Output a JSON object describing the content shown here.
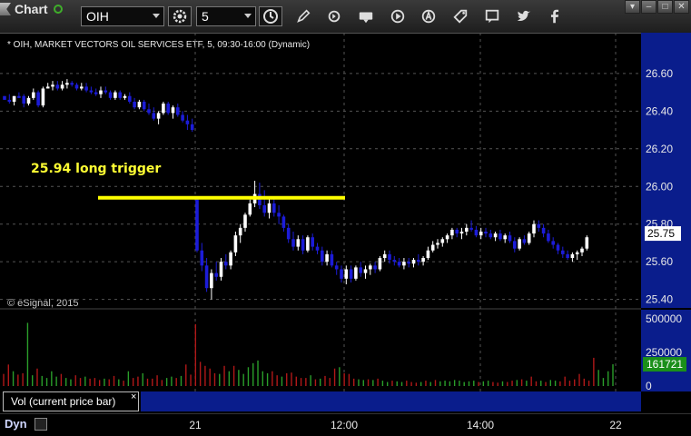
{
  "toolbar": {
    "title": "Chart",
    "symbol": "OIH",
    "interval": "5",
    "icons": [
      "pencil-icon",
      "refresh-icon",
      "get-icon",
      "play-icon",
      "alert-icon",
      "tag-icon",
      "chat-icon",
      "twitter-icon",
      "facebook-icon"
    ]
  },
  "window_controls": [
    "▾",
    "–",
    "□",
    "✕"
  ],
  "chart_header": "* OIH, MARKET VECTORS OIL SERVICES ETF, 5, 09:30-16:00 (Dynamic)",
  "watermark": "© eSignal, 2015",
  "annotation": "25.94 long trigger",
  "vol_study_label": "Vol (current price bar)",
  "vol_close_glyph": "×",
  "dyn_label": "Dyn",
  "colors": {
    "up": "#ffffff",
    "down": "#1c1cd8",
    "trigger": "#ffff00",
    "axis_bg": "#0a1d8c",
    "vol_up": "#2a9e2a",
    "vol_down": "#b01818"
  },
  "chart_data": [
    {
      "type": "candlestick",
      "ylim": [
        25.35,
        26.72
      ],
      "y_ticks": [
        26.6,
        26.4,
        26.2,
        26.0,
        25.8,
        25.6,
        25.4
      ],
      "x_ticks": [
        "21",
        "12:00",
        "14:00",
        "22"
      ],
      "last_price": "25.75",
      "trigger_level": 25.94,
      "session_break_bar": 40,
      "candles": [
        [
          26.48,
          26.48,
          26.46,
          26.46
        ],
        [
          26.46,
          26.49,
          26.44,
          26.45
        ],
        [
          26.45,
          26.48,
          26.43,
          26.48
        ],
        [
          26.48,
          26.5,
          26.47,
          26.47
        ],
        [
          26.48,
          26.49,
          26.42,
          26.44
        ],
        [
          26.44,
          26.48,
          26.43,
          26.47
        ],
        [
          26.47,
          26.52,
          26.46,
          26.5
        ],
        [
          26.5,
          26.51,
          26.42,
          26.43
        ],
        [
          26.43,
          26.53,
          26.42,
          26.52
        ],
        [
          26.52,
          26.55,
          26.52,
          26.53
        ],
        [
          26.53,
          26.56,
          26.51,
          26.54
        ],
        [
          26.54,
          26.56,
          26.51,
          26.52
        ],
        [
          26.52,
          26.56,
          26.51,
          26.54
        ],
        [
          26.54,
          26.57,
          26.52,
          26.55
        ],
        [
          26.55,
          26.56,
          26.53,
          26.54
        ],
        [
          26.54,
          26.55,
          26.51,
          26.52
        ],
        [
          26.52,
          26.55,
          26.51,
          26.53
        ],
        [
          26.53,
          26.55,
          26.5,
          26.51
        ],
        [
          26.51,
          26.53,
          26.49,
          26.5
        ],
        [
          26.5,
          26.52,
          26.48,
          26.49
        ],
        [
          26.49,
          26.53,
          26.47,
          26.51
        ],
        [
          26.51,
          26.53,
          26.49,
          26.5
        ],
        [
          26.5,
          26.51,
          26.46,
          26.47
        ],
        [
          26.47,
          26.51,
          26.46,
          26.5
        ],
        [
          26.5,
          26.51,
          26.46,
          26.47
        ],
        [
          26.47,
          26.49,
          26.46,
          26.48
        ],
        [
          26.48,
          26.5,
          26.44,
          26.45
        ],
        [
          26.45,
          26.47,
          26.41,
          26.42
        ],
        [
          26.42,
          26.46,
          26.41,
          26.45
        ],
        [
          26.45,
          26.46,
          26.4,
          26.41
        ],
        [
          26.41,
          26.44,
          26.38,
          26.39
        ],
        [
          26.39,
          26.42,
          26.35,
          26.36
        ],
        [
          26.36,
          26.4,
          26.33,
          26.39
        ],
        [
          26.39,
          26.45,
          26.38,
          26.44
        ],
        [
          26.44,
          26.45,
          26.38,
          26.39
        ],
        [
          26.39,
          26.43,
          26.36,
          26.42
        ],
        [
          26.42,
          26.44,
          26.37,
          26.38
        ],
        [
          26.38,
          26.4,
          26.34,
          26.35
        ],
        [
          26.35,
          26.38,
          26.3,
          26.33
        ],
        [
          26.33,
          26.36,
          26.29,
          26.3
        ],
        [
          25.94,
          25.94,
          25.65,
          25.66
        ],
        [
          25.66,
          25.7,
          25.55,
          25.58
        ],
        [
          25.58,
          25.62,
          25.44,
          25.46
        ],
        [
          25.46,
          25.56,
          25.4,
          25.54
        ],
        [
          25.54,
          25.6,
          25.5,
          25.52
        ],
        [
          25.52,
          25.62,
          25.5,
          25.6
        ],
        [
          25.6,
          25.64,
          25.56,
          25.58
        ],
        [
          25.58,
          25.66,
          25.56,
          25.65
        ],
        [
          25.65,
          25.76,
          25.63,
          25.74
        ],
        [
          25.74,
          25.8,
          25.7,
          25.78
        ],
        [
          25.78,
          25.86,
          25.76,
          25.85
        ],
        [
          25.85,
          25.93,
          25.84,
          25.91
        ],
        [
          25.91,
          26.03,
          25.89,
          25.96
        ],
        [
          25.96,
          26.02,
          25.88,
          25.9
        ],
        [
          25.9,
          25.98,
          25.84,
          25.86
        ],
        [
          25.86,
          25.94,
          25.83,
          25.91
        ],
        [
          25.91,
          25.94,
          25.84,
          25.86
        ],
        [
          25.86,
          25.9,
          25.8,
          25.84
        ],
        [
          25.84,
          25.85,
          25.76,
          25.78
        ],
        [
          25.78,
          25.8,
          25.7,
          25.72
        ],
        [
          25.72,
          25.76,
          25.66,
          25.68
        ],
        [
          25.68,
          25.74,
          25.66,
          25.72
        ],
        [
          25.72,
          25.74,
          25.64,
          25.66
        ],
        [
          25.66,
          25.74,
          25.65,
          25.73
        ],
        [
          25.73,
          25.75,
          25.66,
          25.68
        ],
        [
          25.68,
          25.7,
          25.64,
          25.66
        ],
        [
          25.66,
          25.68,
          25.58,
          25.6
        ],
        [
          25.6,
          25.66,
          25.58,
          25.64
        ],
        [
          25.64,
          25.66,
          25.57,
          25.58
        ],
        [
          25.58,
          25.6,
          25.53,
          25.56
        ],
        [
          25.56,
          25.58,
          25.49,
          25.51
        ],
        [
          25.51,
          25.58,
          25.48,
          25.56
        ],
        [
          25.56,
          25.58,
          25.49,
          25.51
        ],
        [
          25.51,
          25.58,
          25.5,
          25.57
        ],
        [
          25.57,
          25.6,
          25.52,
          25.54
        ],
        [
          25.54,
          25.58,
          25.51,
          25.56
        ],
        [
          25.56,
          25.59,
          25.53,
          25.58
        ],
        [
          25.58,
          25.6,
          25.54,
          25.56
        ],
        [
          25.56,
          25.63,
          25.55,
          25.62
        ],
        [
          25.62,
          25.66,
          25.6,
          25.64
        ],
        [
          25.64,
          25.66,
          25.59,
          25.61
        ],
        [
          25.61,
          25.63,
          25.58,
          25.6
        ],
        [
          25.6,
          25.62,
          25.57,
          25.58
        ],
        [
          25.58,
          25.62,
          25.56,
          25.6
        ],
        [
          25.6,
          25.62,
          25.57,
          25.59
        ],
        [
          25.59,
          25.62,
          25.57,
          25.61
        ],
        [
          25.61,
          25.64,
          25.58,
          25.6
        ],
        [
          25.6,
          25.63,
          25.58,
          25.62
        ],
        [
          25.62,
          25.68,
          25.61,
          25.66
        ],
        [
          25.66,
          25.71,
          25.65,
          25.69
        ],
        [
          25.69,
          25.72,
          25.67,
          25.7
        ],
        [
          25.7,
          25.73,
          25.68,
          25.72
        ],
        [
          25.72,
          25.75,
          25.7,
          25.74
        ],
        [
          25.74,
          25.78,
          25.72,
          25.77
        ],
        [
          25.77,
          25.78,
          25.73,
          25.75
        ],
        [
          25.75,
          25.78,
          25.72,
          25.76
        ],
        [
          25.76,
          25.8,
          25.74,
          25.78
        ],
        [
          25.78,
          25.82,
          25.76,
          25.77
        ],
        [
          25.77,
          25.79,
          25.73,
          25.74
        ],
        [
          25.74,
          25.78,
          25.72,
          25.76
        ],
        [
          25.76,
          25.78,
          25.73,
          25.75
        ],
        [
          25.75,
          25.77,
          25.72,
          25.73
        ],
        [
          25.73,
          25.76,
          25.71,
          25.75
        ],
        [
          25.75,
          25.77,
          25.71,
          25.72
        ],
        [
          25.72,
          25.75,
          25.7,
          25.74
        ],
        [
          25.74,
          25.76,
          25.7,
          25.71
        ],
        [
          25.71,
          25.73,
          25.65,
          25.67
        ],
        [
          25.67,
          25.73,
          25.66,
          25.72
        ],
        [
          25.72,
          25.74,
          25.69,
          25.7
        ],
        [
          25.7,
          25.76,
          25.69,
          25.75
        ],
        [
          25.75,
          25.82,
          25.73,
          25.8
        ],
        [
          25.8,
          25.82,
          25.76,
          25.78
        ],
        [
          25.78,
          25.8,
          25.73,
          25.75
        ],
        [
          25.75,
          25.77,
          25.7,
          25.71
        ],
        [
          25.71,
          25.73,
          25.67,
          25.69
        ],
        [
          25.69,
          25.7,
          25.64,
          25.66
        ],
        [
          25.66,
          25.68,
          25.62,
          25.64
        ],
        [
          25.64,
          25.66,
          25.61,
          25.62
        ],
        [
          25.62,
          25.65,
          25.6,
          25.64
        ],
        [
          25.64,
          25.66,
          25.61,
          25.65
        ],
        [
          25.65,
          25.68,
          25.63,
          25.67
        ],
        [
          25.67,
          25.74,
          25.66,
          25.73
        ]
      ]
    },
    {
      "type": "bar",
      "title": "Vol (current price bar)",
      "ylim": [
        0,
        520000
      ],
      "y_ticks": [
        0,
        250000,
        500000
      ],
      "last_value": "161721",
      "values": [
        90000,
        160000,
        110000,
        85000,
        95000,
        470000,
        80000,
        130000,
        75000,
        60000,
        110000,
        70000,
        90000,
        60000,
        50000,
        80000,
        60000,
        70000,
        55000,
        60000,
        45000,
        55000,
        50000,
        75000,
        50000,
        40000,
        110000,
        60000,
        70000,
        95000,
        55000,
        55000,
        80000,
        45000,
        60000,
        70000,
        60000,
        75000,
        160000,
        85000,
        460000,
        180000,
        150000,
        130000,
        95000,
        90000,
        150000,
        110000,
        150000,
        120000,
        90000,
        140000,
        170000,
        190000,
        110000,
        95000,
        110000,
        80000,
        70000,
        95000,
        100000,
        70000,
        60000,
        60000,
        80000,
        50000,
        55000,
        75000,
        60000,
        130000,
        140000,
        95000,
        90000,
        55000,
        50000,
        45000,
        50000,
        45000,
        55000,
        40000,
        30000,
        40000,
        35000,
        30000,
        40000,
        30000,
        25000,
        30000,
        40000,
        30000,
        45000,
        35000,
        40000,
        35000,
        45000,
        40000,
        30000,
        35000,
        40000,
        30000,
        35000,
        40000,
        30000,
        25000,
        35000,
        30000,
        40000,
        45000,
        50000,
        40000,
        70000,
        35000,
        40000,
        30000,
        45000,
        40000,
        35000,
        70000,
        40000,
        50000,
        90000,
        55000,
        40000,
        210000,
        120000,
        60000,
        110000,
        161721
      ]
    }
  ]
}
